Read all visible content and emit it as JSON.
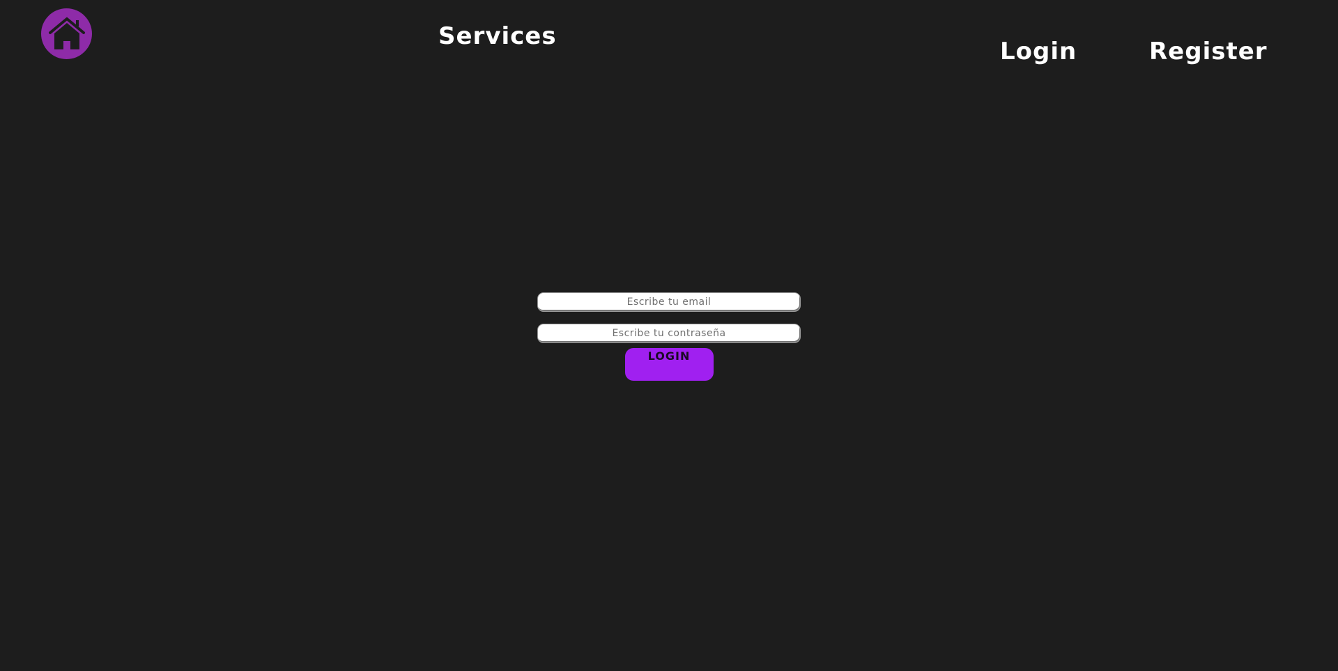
{
  "header": {
    "home_icon": "home-icon",
    "brand_color": "#8e2ba8",
    "nav": {
      "services_label": "Services",
      "login_label": "Login",
      "register_label": "Register"
    }
  },
  "login_form": {
    "email_placeholder": "Escribe tu email",
    "email_value": "",
    "password_placeholder": "Escribe tu contraseña",
    "password_value": "",
    "submit_label": "LOGIN",
    "submit_color": "#a020f0"
  },
  "colors": {
    "background": "#1d1d1d",
    "nav_text": "#ffffff"
  }
}
